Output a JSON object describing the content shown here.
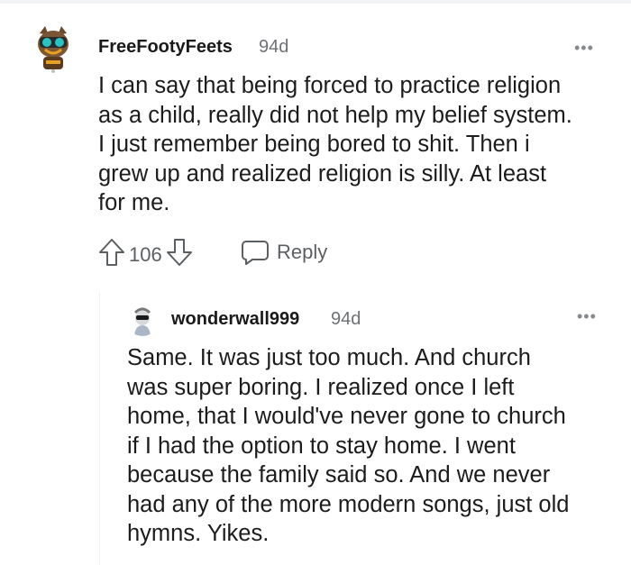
{
  "comment": {
    "username": "FreeFootyFeets",
    "age": "94d",
    "more_icon": "more-dots-icon",
    "lines": [
      "I can say that being forced to practice religion",
      "as a child, really did not help my belief system.",
      "I just remember being bored to shit. Then i",
      "grew up and realized religion is silly. At least",
      "for me."
    ],
    "vote_count": "106",
    "reply_label": "Reply"
  },
  "reply": {
    "username": "wonderwall999",
    "age": "94d",
    "more_icon": "more-dots-icon",
    "lines": [
      "Same. It was just too much. And church",
      "was super boring. I realized once I left",
      "home, that I would've never gone to church",
      "if I had the option to stay home. I went",
      "because the family said so. And we never",
      "had any of the more modern songs, just old",
      "hymns. Yikes."
    ]
  },
  "colors": {
    "text": "#1c1c1c",
    "meta": "#6e7276",
    "icon": "#5c5f62",
    "thread_line": "#edeff1"
  }
}
